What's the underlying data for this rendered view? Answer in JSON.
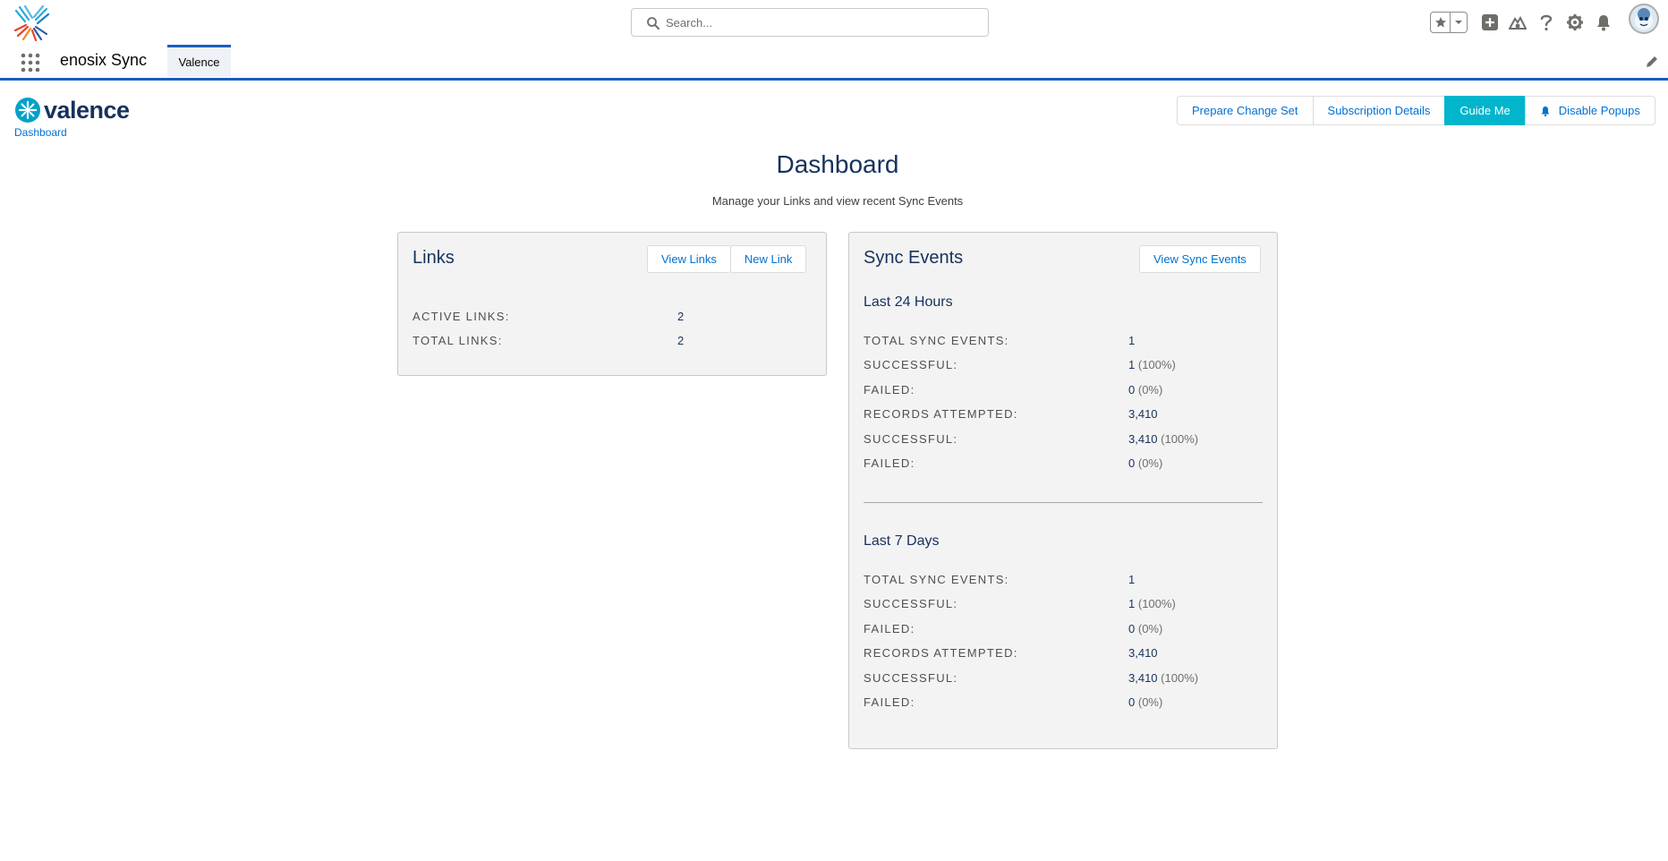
{
  "header": {
    "search_placeholder": "Search...",
    "icons": [
      "favorites-star-icon",
      "favorites-dropdown-icon",
      "add-icon",
      "trailhead-icon",
      "help-icon",
      "setup-gear-icon",
      "notifications-bell-icon",
      "user-avatar"
    ]
  },
  "nav": {
    "app_name": "enosix Sync",
    "tab_label": "Valence"
  },
  "page": {
    "brand_name": "valence",
    "breadcrumb": "Dashboard",
    "title": "Dashboard",
    "subtitle": "Manage your Links and view recent Sync Events",
    "buttons": {
      "prepare_change_set": "Prepare Change Set",
      "subscription_details": "Subscription Details",
      "guide_me": "Guide Me",
      "disable_popups": "Disable Popups"
    }
  },
  "links_card": {
    "title": "Links",
    "view_links": "View Links",
    "new_link": "New Link",
    "stats": [
      {
        "label": "Active Links:",
        "value": "2"
      },
      {
        "label": "Total Links:",
        "value": "2"
      }
    ]
  },
  "sync_card": {
    "title": "Sync Events",
    "view_sync_events": "View Sync Events",
    "last_24": {
      "heading": "Last 24 Hours",
      "rows": [
        {
          "label": "Total Sync Events:",
          "value": "1",
          "pct": ""
        },
        {
          "label": "Successful:",
          "value": "1",
          "pct": "(100%)"
        },
        {
          "label": "Failed:",
          "value": "0",
          "pct": "(0%)"
        },
        {
          "label": "Records Attempted:",
          "value": "3,410",
          "pct": ""
        },
        {
          "label": "Successful:",
          "value": "3,410",
          "pct": "(100%)"
        },
        {
          "label": "Failed:",
          "value": "0",
          "pct": "(0%)"
        }
      ]
    },
    "last_7": {
      "heading": "Last 7 Days",
      "rows": [
        {
          "label": "Total Sync Events:",
          "value": "1",
          "pct": ""
        },
        {
          "label": "Successful:",
          "value": "1",
          "pct": "(100%)"
        },
        {
          "label": "Failed:",
          "value": "0",
          "pct": "(0%)"
        },
        {
          "label": "Records Attempted:",
          "value": "3,410",
          "pct": ""
        },
        {
          "label": "Successful:",
          "value": "3,410",
          "pct": "(100%)"
        },
        {
          "label": "Failed:",
          "value": "0",
          "pct": "(0%)"
        }
      ]
    }
  },
  "colors": {
    "brand_blue": "#16325c",
    "link_blue": "#0070d2",
    "guide_teal": "#00b5cc",
    "nav_accent": "#1b5dbe"
  }
}
